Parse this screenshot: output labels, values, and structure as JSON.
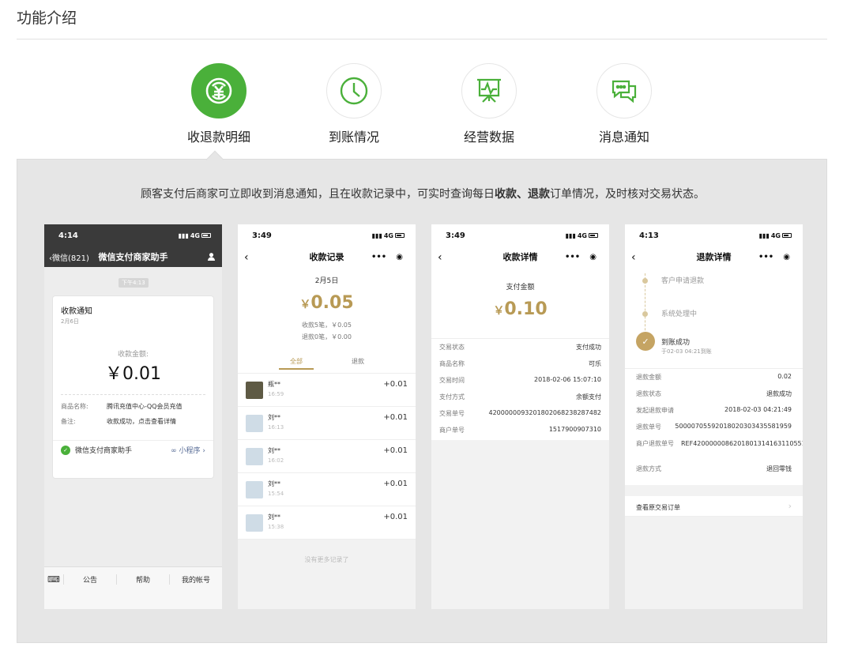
{
  "page": {
    "title": "功能介绍"
  },
  "tabs": [
    {
      "label": "收退款明细",
      "icon": "yuan-exchange-icon",
      "active": true
    },
    {
      "label": "到账情况",
      "icon": "clock-icon",
      "active": false
    },
    {
      "label": "经营数据",
      "icon": "chart-board-icon",
      "active": false
    },
    {
      "label": "消息通知",
      "icon": "chat-bubbles-icon",
      "active": false
    }
  ],
  "description": {
    "pre": "顾客支付后商家可立即收到消息通知，且在收款记录中，可实时查询每日",
    "bold": "收款、退款",
    "post": "订单情况，及时核对交易状态。"
  },
  "colors": {
    "accent": "#4ab03a",
    "gold": "#b89a55",
    "panel": "#e6e6e6"
  },
  "phone1": {
    "time": "4:14",
    "signal": "4G",
    "back": "微信(821)",
    "title": "微信支付商家助手",
    "timechip": "下午4:13",
    "card": {
      "title": "收款通知",
      "date": "2月6日",
      "amount_label": "收款金额:",
      "amount": "￥0.01",
      "rows": [
        {
          "k": "商品名称:",
          "v": "腾讯充值中心-QQ会员充值"
        },
        {
          "k": "备注:",
          "v": "收款成功，点击查看详情"
        }
      ],
      "footer": "微信支付商家助手",
      "mini": "小程序"
    },
    "tabbar": [
      "公告",
      "帮助",
      "我的帐号"
    ]
  },
  "phone2": {
    "time": "3:49",
    "signal": "4G",
    "title": "收款记录",
    "date": "2月5日",
    "currency": "￥",
    "amount": "0.05",
    "stat1": "收款5笔，￥0.05",
    "stat2": "退款0笔，￥0.00",
    "seg": [
      "全部",
      "退款"
    ],
    "items": [
      {
        "name": "瓶**",
        "time": "16:59",
        "amount": "+0.01"
      },
      {
        "name": "刘**",
        "time": "16:13",
        "amount": "+0.01"
      },
      {
        "name": "刘**",
        "time": "16:02",
        "amount": "+0.01"
      },
      {
        "name": "刘**",
        "time": "15:54",
        "amount": "+0.01"
      },
      {
        "name": "刘**",
        "time": "15:38",
        "amount": "+0.01"
      }
    ],
    "more": "没有更多记录了"
  },
  "phone3": {
    "time": "3:49",
    "signal": "4G",
    "title": "收款详情",
    "label": "支付金额",
    "currency": "￥",
    "amount": "0.10",
    "rows": [
      {
        "k": "交易状态",
        "v": "支付成功"
      },
      {
        "k": "商品名称",
        "v": "可乐"
      },
      {
        "k": "交易时间",
        "v": "2018-02-06 15:07:10"
      },
      {
        "k": "支付方式",
        "v": "余额支付"
      },
      {
        "k": "交易单号",
        "v": "4200000093201802068238287482"
      },
      {
        "k": "商户单号",
        "v": "1517900907310"
      }
    ]
  },
  "phone4": {
    "time": "4:13",
    "signal": "4G",
    "title": "退款详情",
    "steps": [
      "客户申请退款",
      "系统处理中",
      "到账成功"
    ],
    "step_sub": "于02-03 04:21到账",
    "rows": [
      {
        "k": "退款金额",
        "v": "0.02"
      },
      {
        "k": "退款状态",
        "v": "退款成功"
      },
      {
        "k": "发起退款申请",
        "v": "2018-02-03 04:21:49"
      },
      {
        "k": "退款单号",
        "v": "50000705592018020303435581959"
      },
      {
        "k": "商户退款单号",
        "v": "REF4200000086201801314163110551"
      },
      {
        "k": "退款方式",
        "v": "退回零钱"
      }
    ],
    "orig": "查看原交易订单"
  }
}
